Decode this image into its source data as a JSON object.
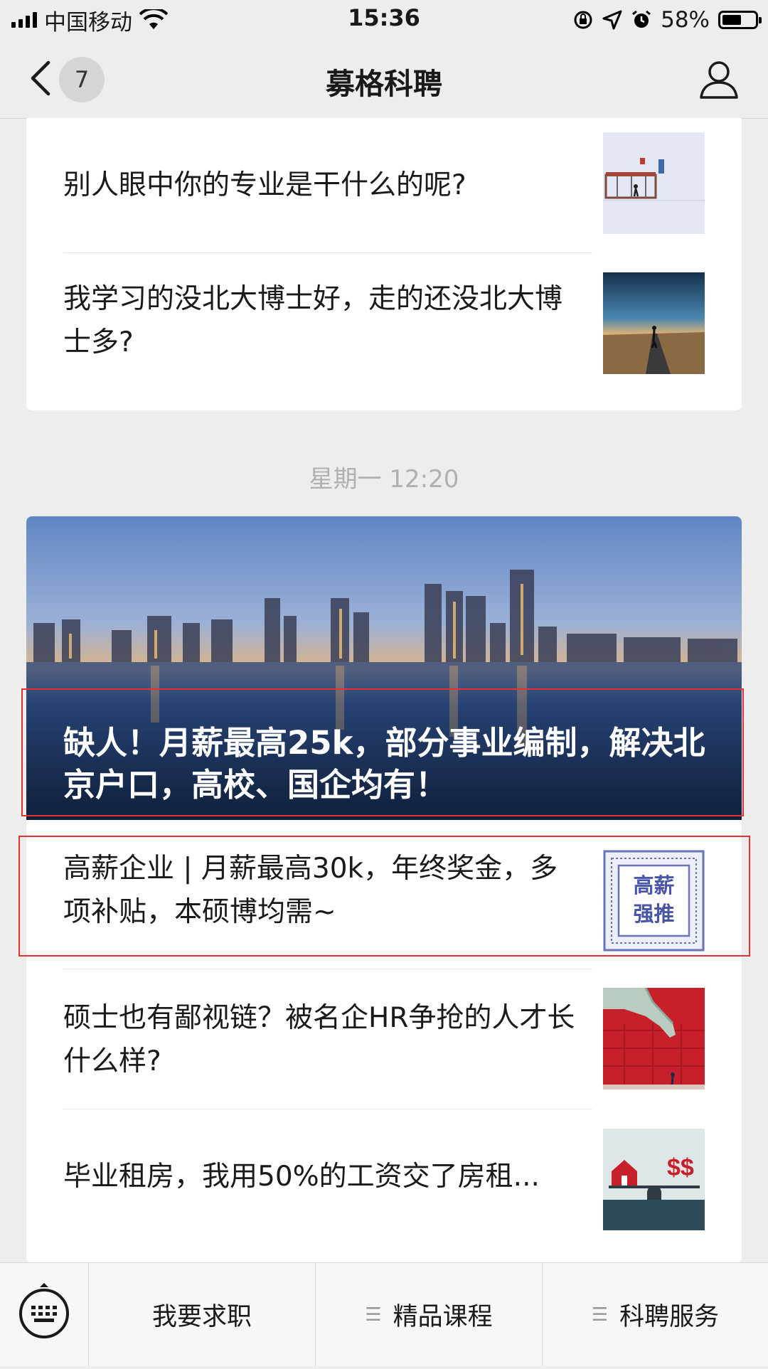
{
  "status_bar": {
    "carrier": "中国移动",
    "time": "15:36",
    "battery_percent": "58%",
    "battery_level": 0.58
  },
  "nav": {
    "unread_count": "7",
    "title": "募格科聘"
  },
  "card1": {
    "items": [
      {
        "title": "别人眼中你的专业是干什么的呢?"
      },
      {
        "title": "我学习的没北大博士好，走的还没北大博士多?"
      }
    ]
  },
  "timestamp": "星期一 12:20",
  "card2": {
    "hero_title": "缺人！月薪最高25k，部分事业编制，解决北京户口，高校、国企均有！",
    "items": [
      {
        "title": "高薪企业 | 月薪最高30k，年终奖金，多项补贴，本硕博均需~",
        "thumb_text_line1": "高薪",
        "thumb_text_line2": "强推"
      },
      {
        "title": "硕士也有鄙视链？被名企HR争抢的人才长什么样?"
      },
      {
        "title": "毕业租房，我用50%的工资交了房租...",
        "thumb_text": "$$"
      }
    ]
  },
  "bottom_menu": {
    "items": [
      {
        "label": "我要求职"
      },
      {
        "label": "精品课程"
      },
      {
        "label": "科聘服务"
      }
    ]
  },
  "colors": {
    "highlight_box": "#e3322f",
    "background": "#ededed"
  }
}
